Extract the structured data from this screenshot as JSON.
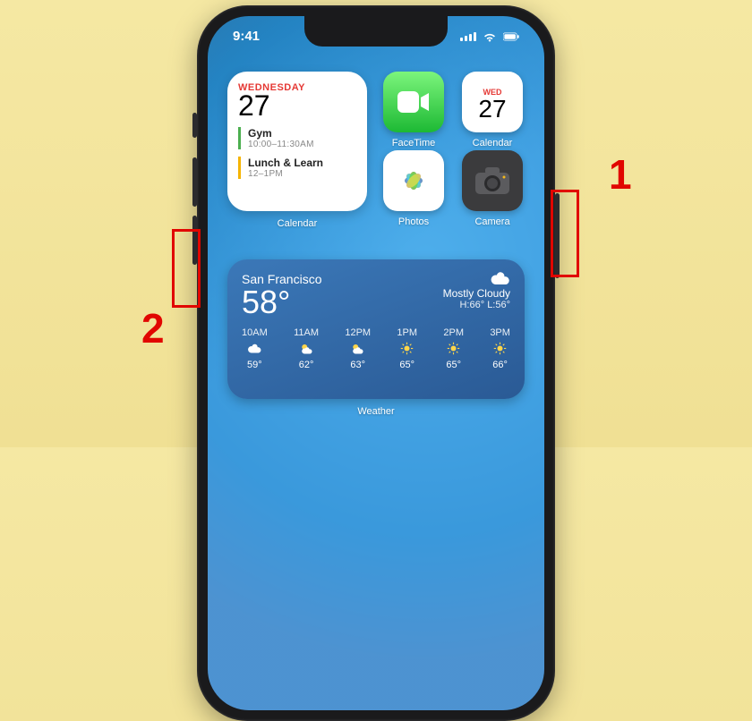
{
  "callouts": {
    "one": "1",
    "two": "2"
  },
  "statusbar": {
    "time": "9:41"
  },
  "calendar_widget": {
    "day_of_week": "WEDNESDAY",
    "day_num": "27",
    "events": [
      {
        "title": "Gym",
        "time": "10:00–11:30AM"
      },
      {
        "title": "Lunch & Learn",
        "time": "12–1PM"
      }
    ],
    "label": "Calendar"
  },
  "apps": {
    "facetime": {
      "label": "FaceTime"
    },
    "calendar": {
      "label": "Calendar",
      "dow": "WED",
      "dnum": "27"
    },
    "photos": {
      "label": "Photos"
    },
    "camera": {
      "label": "Camera"
    }
  },
  "weather": {
    "city": "San Francisco",
    "temp": "58°",
    "condition": "Mostly Cloudy",
    "high": "H:66°",
    "low": "L:56°",
    "hours": [
      {
        "t": "10AM",
        "v": "59°",
        "icon": "cloud"
      },
      {
        "t": "11AM",
        "v": "62°",
        "icon": "partly"
      },
      {
        "t": "12PM",
        "v": "63°",
        "icon": "partly"
      },
      {
        "t": "1PM",
        "v": "65°",
        "icon": "sun"
      },
      {
        "t": "2PM",
        "v": "65°",
        "icon": "sun"
      },
      {
        "t": "3PM",
        "v": "66°",
        "icon": "sun"
      }
    ],
    "label": "Weather"
  }
}
